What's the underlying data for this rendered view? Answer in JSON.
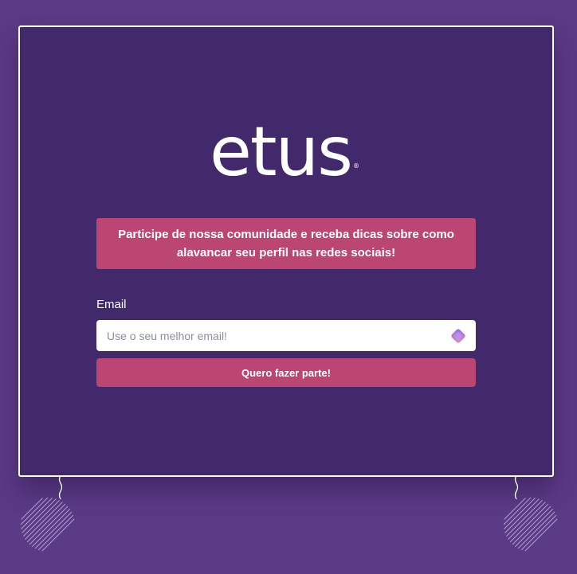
{
  "brand": {
    "logo_text": "etus",
    "registered_mark": "®"
  },
  "newsletter": {
    "message": "Participe de nossa comunidade e receba dicas sobre como alavancar seu perfil nas redes sociais!",
    "email_label": "Email",
    "email_placeholder": "Use o seu melhor email!",
    "email_value": "",
    "submit_label": "Quero fazer parte!"
  },
  "icons": {
    "field_icon": "diamond-extension-icon",
    "decorations": [
      "wavy-string-icon",
      "striped-ball-icon"
    ]
  },
  "colors": {
    "page_background": "#5b3a86",
    "card_background": "#41296b",
    "accent": "#bb4672",
    "text": "#ffffff"
  }
}
